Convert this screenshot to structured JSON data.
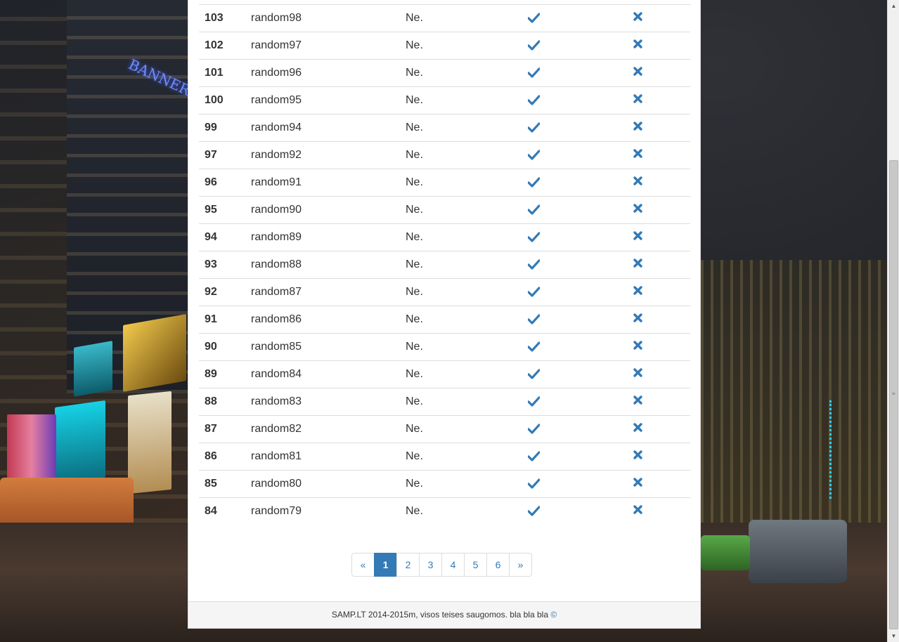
{
  "table": {
    "rows": [
      {
        "id": "103",
        "name": "random98",
        "status": "Ne."
      },
      {
        "id": "102",
        "name": "random97",
        "status": "Ne."
      },
      {
        "id": "101",
        "name": "random96",
        "status": "Ne."
      },
      {
        "id": "100",
        "name": "random95",
        "status": "Ne."
      },
      {
        "id": "99",
        "name": "random94",
        "status": "Ne."
      },
      {
        "id": "97",
        "name": "random92",
        "status": "Ne."
      },
      {
        "id": "96",
        "name": "random91",
        "status": "Ne."
      },
      {
        "id": "95",
        "name": "random90",
        "status": "Ne."
      },
      {
        "id": "94",
        "name": "random89",
        "status": "Ne."
      },
      {
        "id": "93",
        "name": "random88",
        "status": "Ne."
      },
      {
        "id": "92",
        "name": "random87",
        "status": "Ne."
      },
      {
        "id": "91",
        "name": "random86",
        "status": "Ne."
      },
      {
        "id": "90",
        "name": "random85",
        "status": "Ne."
      },
      {
        "id": "89",
        "name": "random84",
        "status": "Ne."
      },
      {
        "id": "88",
        "name": "random83",
        "status": "Ne."
      },
      {
        "id": "87",
        "name": "random82",
        "status": "Ne."
      },
      {
        "id": "86",
        "name": "random81",
        "status": "Ne."
      },
      {
        "id": "85",
        "name": "random80",
        "status": "Ne."
      },
      {
        "id": "84",
        "name": "random79",
        "status": "Ne."
      }
    ],
    "approve_icon": "check-icon",
    "reject_icon": "close-icon",
    "icon_color": "#337ab7"
  },
  "pagination": {
    "prev": "«",
    "pages": [
      "1",
      "2",
      "3",
      "4",
      "5",
      "6"
    ],
    "next": "»",
    "active_page": "1"
  },
  "footer": {
    "text": "SAMP.LT 2014-2015m, visos teises saugomos. bla bla bla",
    "copyright_symbol": "©"
  },
  "background": {
    "sign_text": "BANNER"
  },
  "colors": {
    "accent": "#337ab7",
    "panel_bg": "#ffffff",
    "footer_bg": "#f5f5f5"
  }
}
